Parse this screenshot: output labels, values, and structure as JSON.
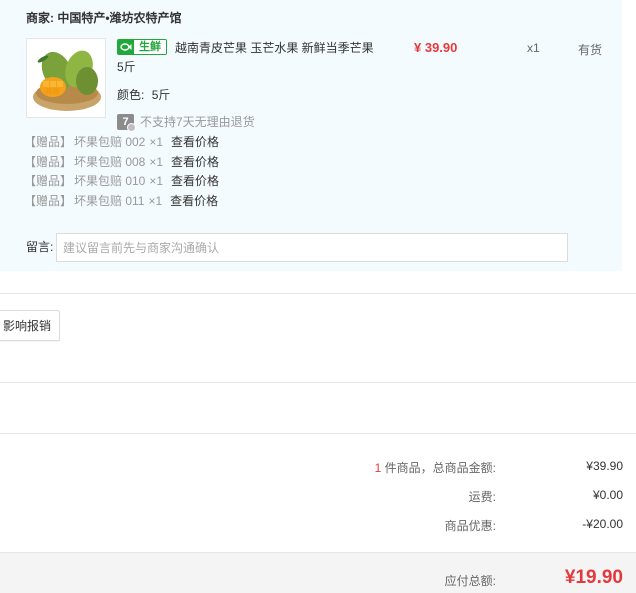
{
  "shop": {
    "label": "商家:",
    "name": "中国特产•潍坊农特产馆"
  },
  "product": {
    "image_icon": "mango-product-image",
    "fresh_tag": "生鲜",
    "fresh_tag_color": "#22a83a",
    "title": "越南青皮芒果 玉芒水果 新鲜当季芒果 5斤",
    "price": "¥ 39.90",
    "quantity": "x1",
    "stock_status": "有货",
    "attr_label": "颜色:",
    "attr_value": "5斤",
    "return_badge": "7",
    "return_policy": "不支持7天无理由退货"
  },
  "gifts": [
    {
      "tag": "【赠品】",
      "name": "坏果包赔 002",
      "qty": "×1",
      "link": "查看价格"
    },
    {
      "tag": "【赠品】",
      "name": "坏果包赔 008",
      "qty": "×1",
      "link": "查看价格"
    },
    {
      "tag": "【赠品】",
      "name": "坏果包赔 010",
      "qty": "×1",
      "link": "查看价格"
    },
    {
      "tag": "【赠品】",
      "name": "坏果包赔 011",
      "qty": "×1",
      "link": "查看价格"
    }
  ],
  "message": {
    "label": "留言:",
    "placeholder": "建议留言前先与商家沟通确认"
  },
  "report_button": "影响报销",
  "summary": {
    "count": "1",
    "items_label": " 件商品，总商品金额:",
    "items_value": "¥39.90",
    "shipping_label": "运费:",
    "shipping_value": "¥0.00",
    "discount_label": "商品优惠:",
    "discount_value": "-¥20.00",
    "total_label": "应付总额:",
    "total_value": "¥19.90"
  },
  "colors": {
    "accent_red": "#e4393c",
    "panel_bg": "#f3fbfe"
  }
}
